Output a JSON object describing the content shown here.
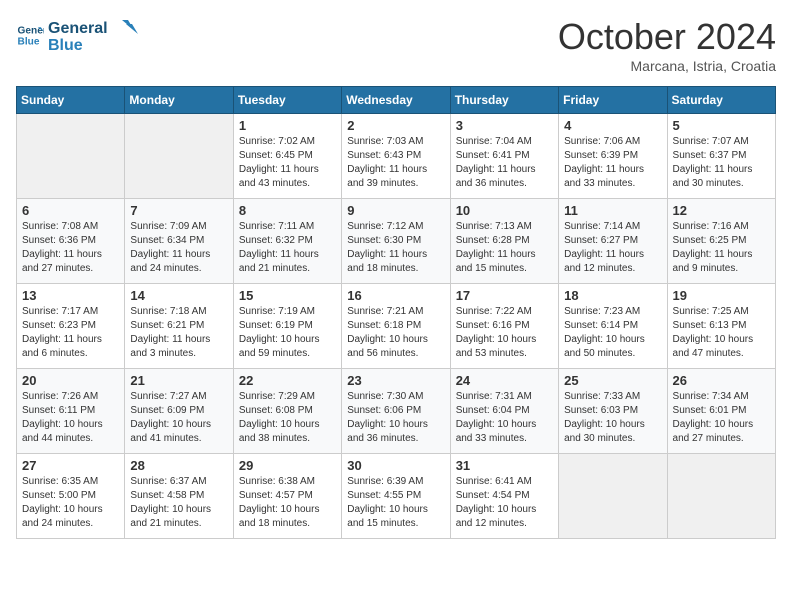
{
  "header": {
    "logo_line1": "General",
    "logo_line2": "Blue",
    "month": "October 2024",
    "location": "Marcana, Istria, Croatia"
  },
  "weekdays": [
    "Sunday",
    "Monday",
    "Tuesday",
    "Wednesday",
    "Thursday",
    "Friday",
    "Saturday"
  ],
  "weeks": [
    [
      {
        "day": "",
        "sunrise": "",
        "sunset": "",
        "daylight": ""
      },
      {
        "day": "",
        "sunrise": "",
        "sunset": "",
        "daylight": ""
      },
      {
        "day": "1",
        "sunrise": "Sunrise: 7:02 AM",
        "sunset": "Sunset: 6:45 PM",
        "daylight": "Daylight: 11 hours and 43 minutes."
      },
      {
        "day": "2",
        "sunrise": "Sunrise: 7:03 AM",
        "sunset": "Sunset: 6:43 PM",
        "daylight": "Daylight: 11 hours and 39 minutes."
      },
      {
        "day": "3",
        "sunrise": "Sunrise: 7:04 AM",
        "sunset": "Sunset: 6:41 PM",
        "daylight": "Daylight: 11 hours and 36 minutes."
      },
      {
        "day": "4",
        "sunrise": "Sunrise: 7:06 AM",
        "sunset": "Sunset: 6:39 PM",
        "daylight": "Daylight: 11 hours and 33 minutes."
      },
      {
        "day": "5",
        "sunrise": "Sunrise: 7:07 AM",
        "sunset": "Sunset: 6:37 PM",
        "daylight": "Daylight: 11 hours and 30 minutes."
      }
    ],
    [
      {
        "day": "6",
        "sunrise": "Sunrise: 7:08 AM",
        "sunset": "Sunset: 6:36 PM",
        "daylight": "Daylight: 11 hours and 27 minutes."
      },
      {
        "day": "7",
        "sunrise": "Sunrise: 7:09 AM",
        "sunset": "Sunset: 6:34 PM",
        "daylight": "Daylight: 11 hours and 24 minutes."
      },
      {
        "day": "8",
        "sunrise": "Sunrise: 7:11 AM",
        "sunset": "Sunset: 6:32 PM",
        "daylight": "Daylight: 11 hours and 21 minutes."
      },
      {
        "day": "9",
        "sunrise": "Sunrise: 7:12 AM",
        "sunset": "Sunset: 6:30 PM",
        "daylight": "Daylight: 11 hours and 18 minutes."
      },
      {
        "day": "10",
        "sunrise": "Sunrise: 7:13 AM",
        "sunset": "Sunset: 6:28 PM",
        "daylight": "Daylight: 11 hours and 15 minutes."
      },
      {
        "day": "11",
        "sunrise": "Sunrise: 7:14 AM",
        "sunset": "Sunset: 6:27 PM",
        "daylight": "Daylight: 11 hours and 12 minutes."
      },
      {
        "day": "12",
        "sunrise": "Sunrise: 7:16 AM",
        "sunset": "Sunset: 6:25 PM",
        "daylight": "Daylight: 11 hours and 9 minutes."
      }
    ],
    [
      {
        "day": "13",
        "sunrise": "Sunrise: 7:17 AM",
        "sunset": "Sunset: 6:23 PM",
        "daylight": "Daylight: 11 hours and 6 minutes."
      },
      {
        "day": "14",
        "sunrise": "Sunrise: 7:18 AM",
        "sunset": "Sunset: 6:21 PM",
        "daylight": "Daylight: 11 hours and 3 minutes."
      },
      {
        "day": "15",
        "sunrise": "Sunrise: 7:19 AM",
        "sunset": "Sunset: 6:19 PM",
        "daylight": "Daylight: 10 hours and 59 minutes."
      },
      {
        "day": "16",
        "sunrise": "Sunrise: 7:21 AM",
        "sunset": "Sunset: 6:18 PM",
        "daylight": "Daylight: 10 hours and 56 minutes."
      },
      {
        "day": "17",
        "sunrise": "Sunrise: 7:22 AM",
        "sunset": "Sunset: 6:16 PM",
        "daylight": "Daylight: 10 hours and 53 minutes."
      },
      {
        "day": "18",
        "sunrise": "Sunrise: 7:23 AM",
        "sunset": "Sunset: 6:14 PM",
        "daylight": "Daylight: 10 hours and 50 minutes."
      },
      {
        "day": "19",
        "sunrise": "Sunrise: 7:25 AM",
        "sunset": "Sunset: 6:13 PM",
        "daylight": "Daylight: 10 hours and 47 minutes."
      }
    ],
    [
      {
        "day": "20",
        "sunrise": "Sunrise: 7:26 AM",
        "sunset": "Sunset: 6:11 PM",
        "daylight": "Daylight: 10 hours and 44 minutes."
      },
      {
        "day": "21",
        "sunrise": "Sunrise: 7:27 AM",
        "sunset": "Sunset: 6:09 PM",
        "daylight": "Daylight: 10 hours and 41 minutes."
      },
      {
        "day": "22",
        "sunrise": "Sunrise: 7:29 AM",
        "sunset": "Sunset: 6:08 PM",
        "daylight": "Daylight: 10 hours and 38 minutes."
      },
      {
        "day": "23",
        "sunrise": "Sunrise: 7:30 AM",
        "sunset": "Sunset: 6:06 PM",
        "daylight": "Daylight: 10 hours and 36 minutes."
      },
      {
        "day": "24",
        "sunrise": "Sunrise: 7:31 AM",
        "sunset": "Sunset: 6:04 PM",
        "daylight": "Daylight: 10 hours and 33 minutes."
      },
      {
        "day": "25",
        "sunrise": "Sunrise: 7:33 AM",
        "sunset": "Sunset: 6:03 PM",
        "daylight": "Daylight: 10 hours and 30 minutes."
      },
      {
        "day": "26",
        "sunrise": "Sunrise: 7:34 AM",
        "sunset": "Sunset: 6:01 PM",
        "daylight": "Daylight: 10 hours and 27 minutes."
      }
    ],
    [
      {
        "day": "27",
        "sunrise": "Sunrise: 6:35 AM",
        "sunset": "Sunset: 5:00 PM",
        "daylight": "Daylight: 10 hours and 24 minutes."
      },
      {
        "day": "28",
        "sunrise": "Sunrise: 6:37 AM",
        "sunset": "Sunset: 4:58 PM",
        "daylight": "Daylight: 10 hours and 21 minutes."
      },
      {
        "day": "29",
        "sunrise": "Sunrise: 6:38 AM",
        "sunset": "Sunset: 4:57 PM",
        "daylight": "Daylight: 10 hours and 18 minutes."
      },
      {
        "day": "30",
        "sunrise": "Sunrise: 6:39 AM",
        "sunset": "Sunset: 4:55 PM",
        "daylight": "Daylight: 10 hours and 15 minutes."
      },
      {
        "day": "31",
        "sunrise": "Sunrise: 6:41 AM",
        "sunset": "Sunset: 4:54 PM",
        "daylight": "Daylight: 10 hours and 12 minutes."
      },
      {
        "day": "",
        "sunrise": "",
        "sunset": "",
        "daylight": ""
      },
      {
        "day": "",
        "sunrise": "",
        "sunset": "",
        "daylight": ""
      }
    ]
  ]
}
